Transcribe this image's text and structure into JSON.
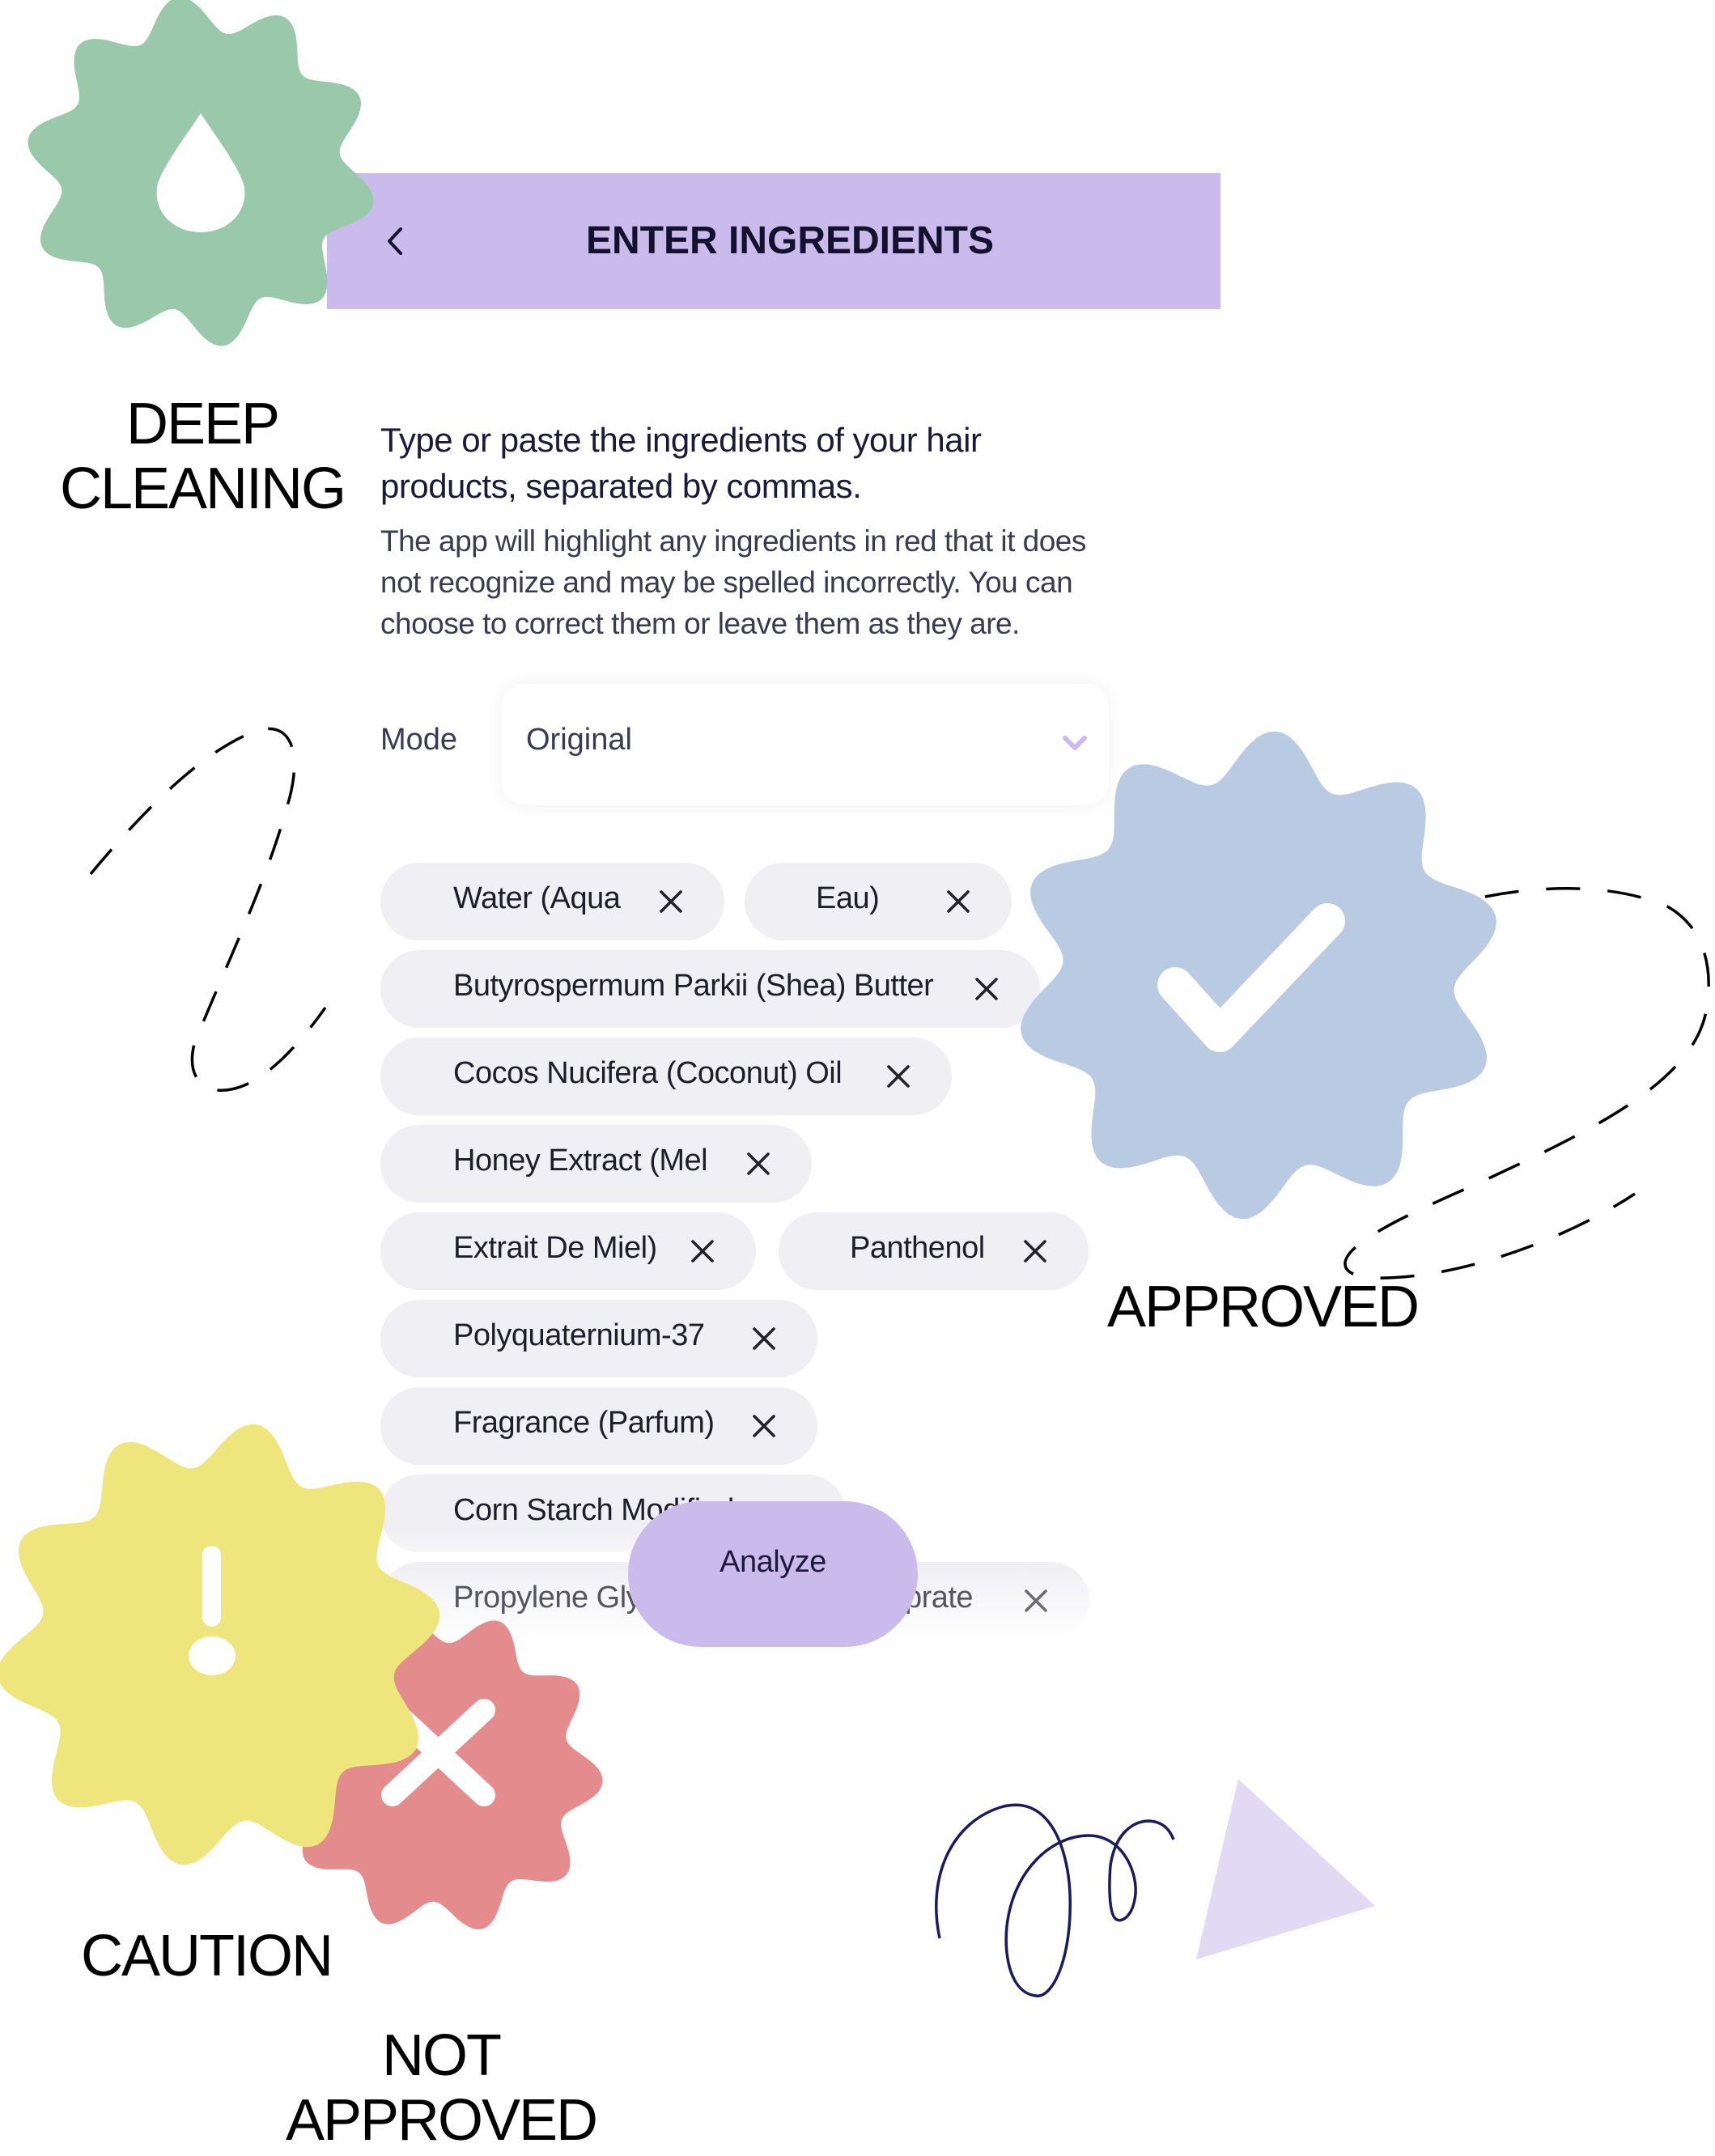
{
  "header": {
    "title": "ENTER INGREDIENTS",
    "back_icon": "chevron-left-icon"
  },
  "intro": {
    "heading_line1": "Type or paste the ingredients of your hair",
    "heading_line2": "products, separated by commas.",
    "body_line1": "The app will highlight any ingredients in red that it does",
    "body_line2": "not recognize and may be spelled incorrectly. You can",
    "body_line3": "choose to correct them or leave them as they are."
  },
  "mode": {
    "label": "Mode",
    "selected": "Original",
    "chevron_icon": "chevron-down-icon"
  },
  "ingredients": [
    "Water (Aqua",
    "Eau)",
    "Butyrospermum Parkii (Shea) Butter",
    "Cocos Nucifera (Coconut) Oil",
    "Honey Extract (Mel",
    "Extrait De Miel)",
    "Panthenol",
    "Polyquaternium-37",
    "Fragrance (Parfum)",
    "Corn Starch Modified",
    "Propylene Glycol Dicaprylate/Dicaprate"
  ],
  "remove_icon": "close-icon",
  "analyze_button": "Analyze",
  "badges": {
    "deep_cleaning": {
      "line1": "DEEP",
      "line2": "CLEANING",
      "icon": "water-drop-icon",
      "color": "#99c9aa"
    },
    "approved": {
      "label": "APPROVED",
      "icon": "checkmark-icon",
      "color": "#b9cbe3"
    },
    "caution": {
      "label": "CAUTION",
      "icon": "exclamation-icon",
      "color": "#efe57d"
    },
    "not_approved": {
      "line1": "NOT",
      "line2": "APPROVED",
      "icon": "x-mark-icon",
      "color": "#e48b8e"
    }
  },
  "colors": {
    "accent": "#cbbbed",
    "chip_bg": "#efeff4",
    "text_dark": "#14112e",
    "scribble": "#1a1a5e",
    "triangle": "#e2d9f5"
  }
}
